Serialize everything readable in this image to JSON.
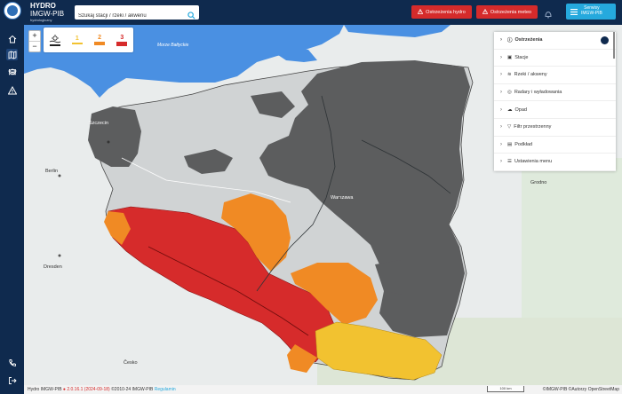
{
  "brand": {
    "line1": "HYDRO",
    "line2": "IMGW-PIB",
    "line3": "hydrologiczny"
  },
  "search": {
    "placeholder": "Szukaj stacji / rzeki / akwenu",
    "icon": "search-icon"
  },
  "header": {
    "alert_hydro": "Ostrzeżenia hydro",
    "alert_meteo": "Ostrzeżenia meteo",
    "services_line1": "Serwisy",
    "services_line2": "IMGW-PIB"
  },
  "sidebar_icons": [
    "home-icon",
    "map-icon",
    "layers-icon",
    "list-icon",
    "warning-icon",
    "phone-icon",
    "logout-icon"
  ],
  "zoom": {
    "in": "+",
    "out": "−"
  },
  "levels": [
    {
      "label": "",
      "color": "#222222"
    },
    {
      "label": "1",
      "color": "#f2c230"
    },
    {
      "label": "2",
      "color": "#f08a24"
    },
    {
      "label": "3",
      "color": "#d62b2b"
    }
  ],
  "panel": {
    "items": [
      {
        "label": "Ostrzeżenia",
        "icon": "info-icon",
        "active": true
      },
      {
        "label": "Stacje",
        "icon": "station-icon",
        "active": false
      },
      {
        "label": "Rzeki / akweny",
        "icon": "river-icon",
        "active": false
      },
      {
        "label": "Radary i wyładowania",
        "icon": "radar-icon",
        "active": false
      },
      {
        "label": "Opad",
        "icon": "cloud-icon",
        "active": false
      },
      {
        "label": "Filtr przestrzenny",
        "icon": "filter-icon",
        "active": false
      },
      {
        "label": "Podkład",
        "icon": "basemap-icon",
        "active": false
      },
      {
        "label": "Ustawienia menu",
        "icon": "settings-icon",
        "active": false
      }
    ]
  },
  "map_labels": {
    "sea1": "Morze Bałtyckie",
    "berlin": "Berlin",
    "dresden": "Dresden",
    "cesko": "Česko",
    "grodno": "Grodno",
    "warszawa": "Warszawa",
    "szczecin": "Szczecin"
  },
  "footer": {
    "left_app": "Hydro IMGW-PIB",
    "version": "2.0.16.1 (2024-09-18)",
    "copyright": "©2010-24 IMGW-PIB",
    "regulamin": "Regulamin",
    "right": "©IMGW-PIB ©Autorzy OpenStreetMap",
    "scale": "100 km"
  },
  "colors": {
    "navy": "#0f2a4e",
    "alert_red": "#d52b2b",
    "services_blue": "#25a9dd",
    "sea": "#4a90e2",
    "grey_zone": "#5a5a5a",
    "red_zone": "#d62b2b",
    "orange_zone": "#f08a24",
    "yellow_zone": "#f2c230"
  }
}
